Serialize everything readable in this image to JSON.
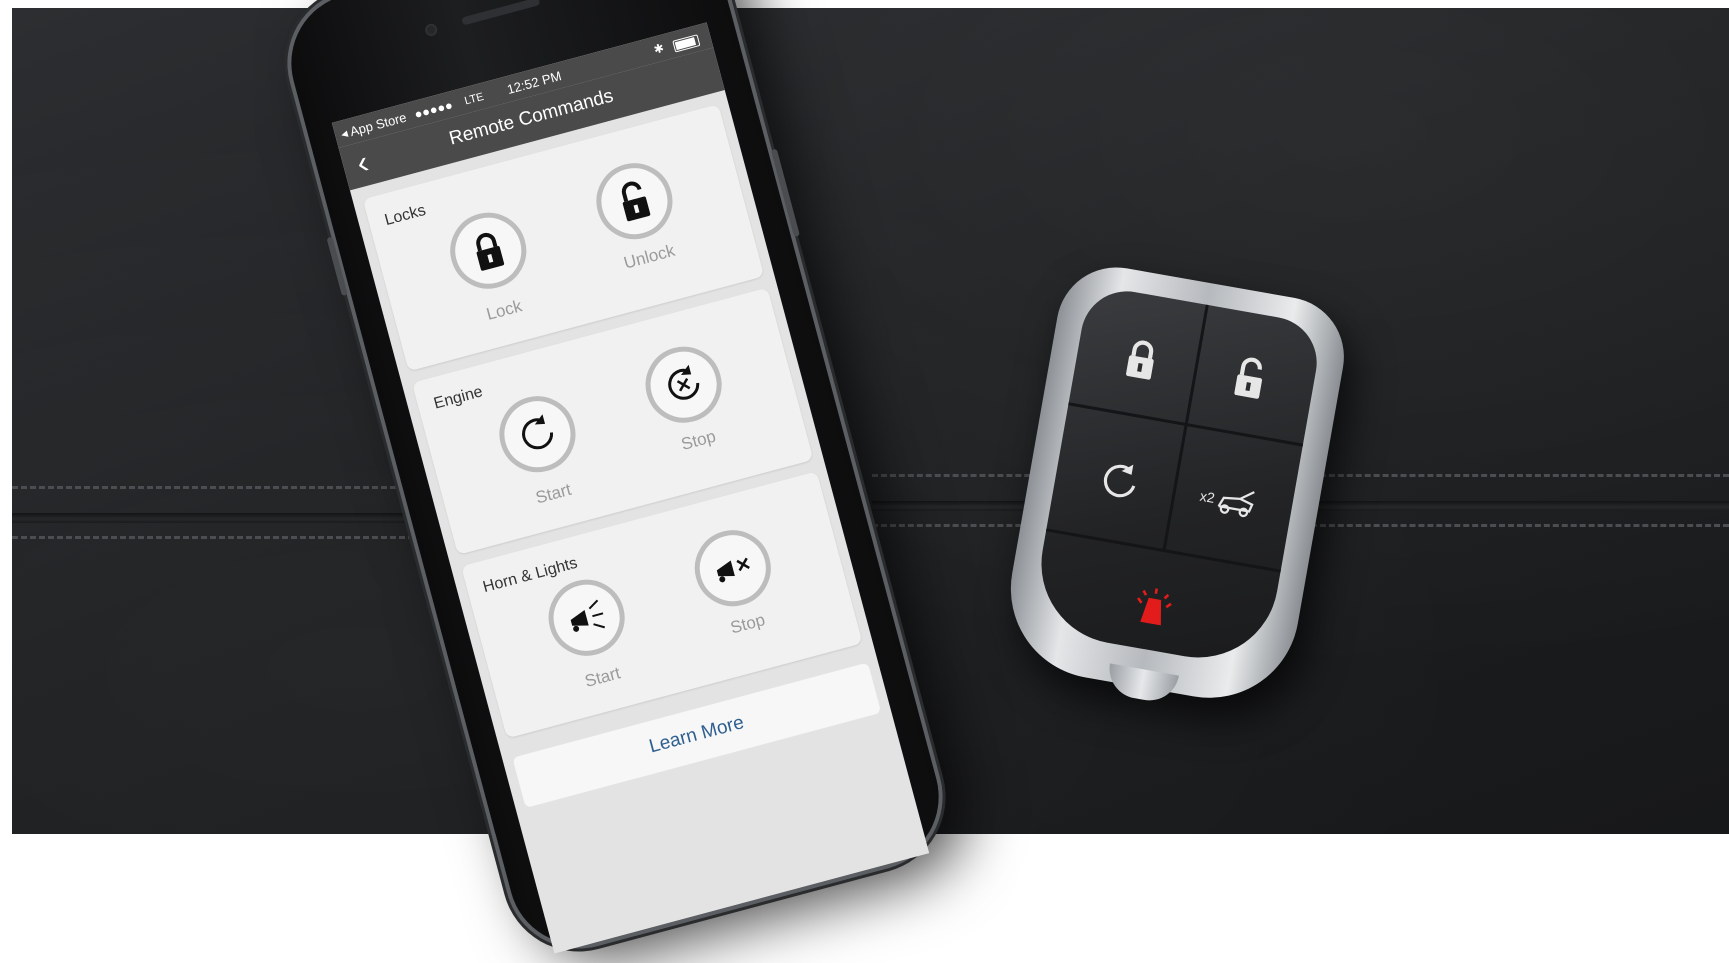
{
  "status_bar": {
    "back_app": "App Store",
    "carrier": "●●●●●",
    "network": "LTE",
    "time": "12:52 PM"
  },
  "nav": {
    "title": "Remote Commands",
    "back_icon": "chevron-left-icon"
  },
  "sections": {
    "locks": {
      "title": "Locks",
      "lock_label": "Lock",
      "unlock_label": "Unlock"
    },
    "engine": {
      "title": "Engine",
      "start_label": "Start",
      "stop_label": "Stop"
    },
    "horn_lights": {
      "title": "Horn & Lights",
      "start_label": "Start",
      "stop_label": "Stop"
    }
  },
  "learn_more": "Learn More",
  "fob": {
    "trunk_label": "x2",
    "panic_color": "#e21b1b"
  },
  "colors": {
    "nav_bar": "#4a4a4a",
    "card": "#f1f1f1",
    "link": "#2f5f8f"
  }
}
